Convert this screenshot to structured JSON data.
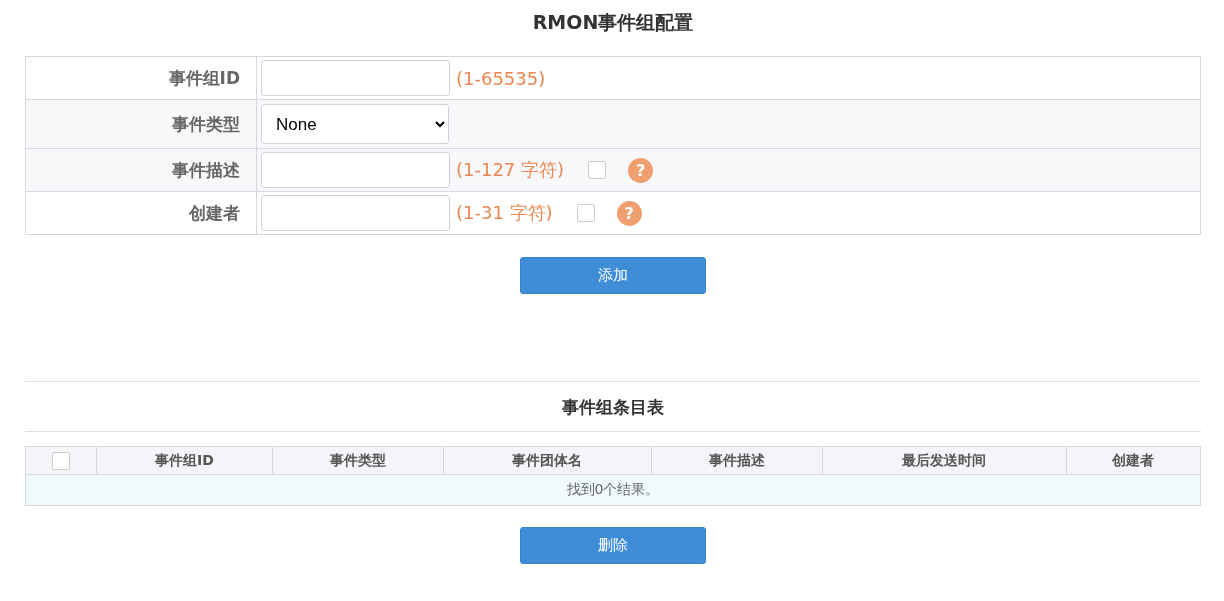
{
  "title": "RMON事件组配置",
  "form": [
    {
      "kind": "text",
      "label": "事件组ID",
      "hint": "(1-65535)"
    },
    {
      "kind": "select",
      "label": "事件类型",
      "value": "None"
    },
    {
      "kind": "text-check",
      "label": "事件描述",
      "hint": "(1-127 字符)",
      "checked": false,
      "help": "?"
    },
    {
      "kind": "text-check",
      "label": "创建者",
      "hint": "(1-31 字符)",
      "checked": false,
      "help": "?"
    }
  ],
  "add_button": "添加",
  "list_title": "事件组条目表",
  "table": {
    "select_all_checked": false,
    "columns": [
      "事件组ID",
      "事件类型",
      "事件团体名",
      "事件描述",
      "最后发送时间",
      "创建者"
    ],
    "empty_message": "找到0个结果。"
  },
  "delete_button": "删除"
}
